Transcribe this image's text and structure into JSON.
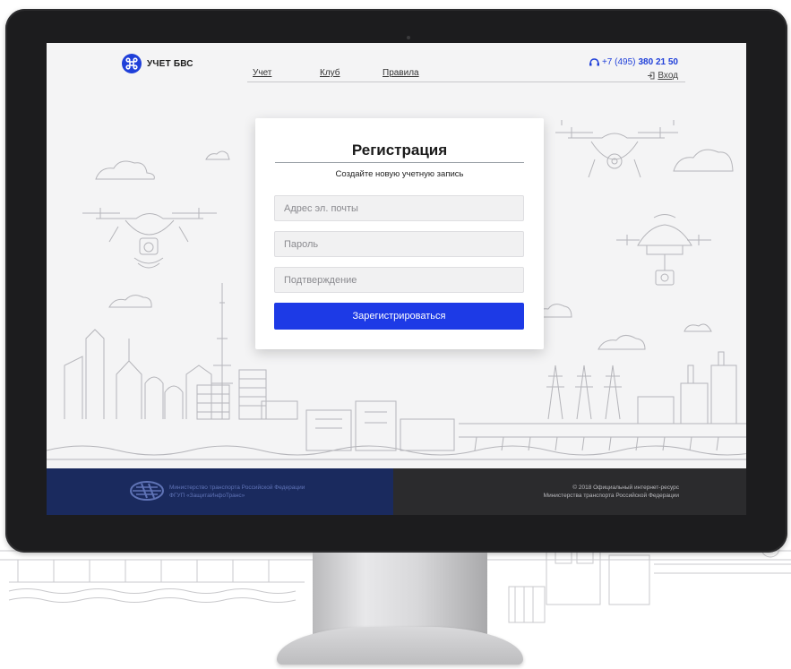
{
  "header": {
    "logo_text_prefix": "УЧЕТ",
    "logo_text_bold": "БВС",
    "nav": [
      {
        "label": "Учет"
      },
      {
        "label": "Клуб"
      },
      {
        "label": "Правила"
      }
    ],
    "phone_prefix": "+7 (495)",
    "phone_number": "380 21 50",
    "login_label": "Вход"
  },
  "form": {
    "title": "Регистрация",
    "subtitle": "Создайте новую учетную запись",
    "email_placeholder": "Адрес эл. почты",
    "password_placeholder": "Пароль",
    "confirm_placeholder": "Подтверждение",
    "submit_label": "Зарегистрироваться"
  },
  "footer": {
    "left_line1": "Министерство транспорта Российской Федерации",
    "left_line2": "ФГУП «ЗащитаИнфоТранс»",
    "right_line1": "© 2018 Официальный интернет-ресурс",
    "right_line2": "Министерства транспорта Российской Федерации"
  },
  "colors": {
    "accent": "#1d3ae6",
    "footer_left": "#1a2a5e",
    "footer_right": "#2b2b2d",
    "screen_bg": "#f4f4f5"
  }
}
